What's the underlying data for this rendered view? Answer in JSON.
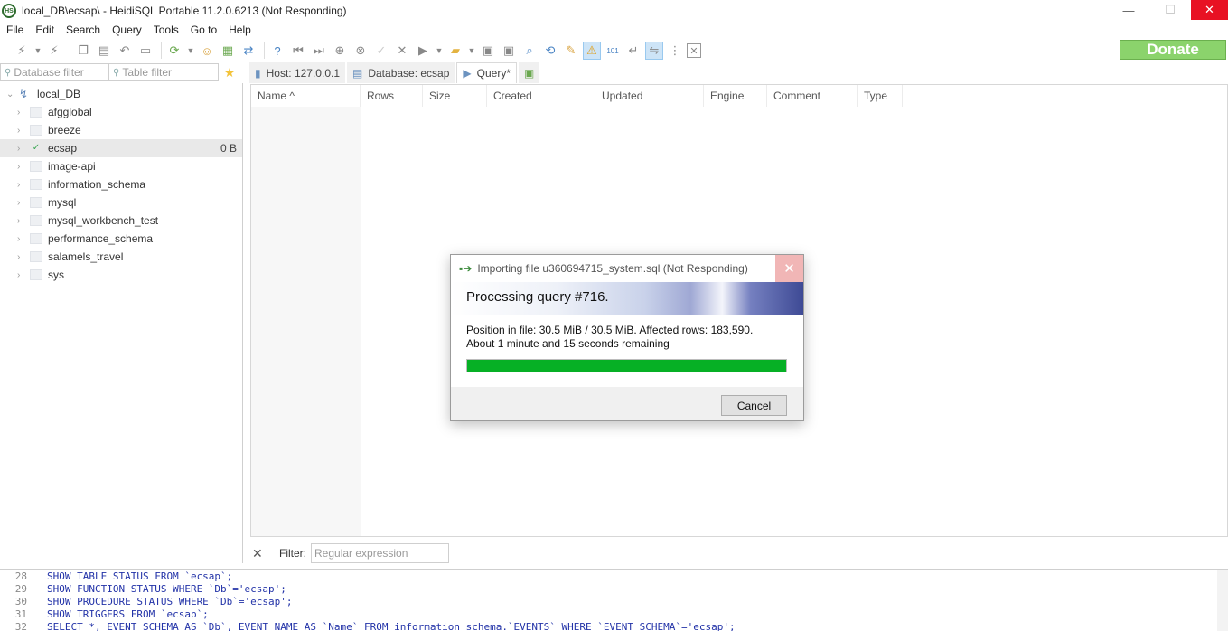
{
  "window": {
    "title": "local_DB\\ecsap\\ - HeidiSQL Portable 11.2.0.6213 (Not Responding)",
    "icon": "heidisql-icon",
    "controls": {
      "minimize": "—",
      "maximize": "☐",
      "close": "✕"
    }
  },
  "menu": [
    "File",
    "Edit",
    "Search",
    "Query",
    "Tools",
    "Go to",
    "Help"
  ],
  "toolbar": {
    "donate_label": "Donate",
    "icons": [
      "connect-icon",
      "dropdown-icon",
      "disconnect-icon",
      "copy-icon",
      "paste-icon",
      "undo-icon",
      "print-icon",
      "refresh-icon",
      "dropdown-icon",
      "user-manager-icon",
      "export-icon",
      "sync-icon",
      "help-icon",
      "first-icon",
      "last-icon",
      "add-icon",
      "remove-icon",
      "apply-icon",
      "cancel-icon",
      "run-icon",
      "dropdown-icon",
      "open-folder-icon",
      "dropdown-icon",
      "save-icon",
      "save-as-icon",
      "find-icon",
      "replace-icon",
      "format-icon",
      "warning-icon",
      "binary-icon",
      "wrap-icon",
      "reformat-icon",
      "more-icon",
      "close-icon"
    ]
  },
  "filters": {
    "database_filter_placeholder": "Database filter",
    "table_filter_placeholder": "Table filter"
  },
  "tabs": [
    {
      "label": "Host: 127.0.0.1",
      "icon": "host-icon"
    },
    {
      "label": "Database: ecsap",
      "icon": "database-icon"
    },
    {
      "label": "Query*",
      "icon": "query-icon"
    },
    {
      "label": "",
      "icon": "new-query-tab-icon"
    }
  ],
  "tree": {
    "root": "local_DB",
    "items": [
      {
        "label": "afgglobal",
        "size": ""
      },
      {
        "label": "breeze",
        "size": ""
      },
      {
        "label": "ecsap",
        "size": "0 B",
        "selected": true
      },
      {
        "label": "image-api",
        "size": ""
      },
      {
        "label": "information_schema",
        "size": ""
      },
      {
        "label": "mysql",
        "size": ""
      },
      {
        "label": "mysql_workbench_test",
        "size": ""
      },
      {
        "label": "performance_schema",
        "size": ""
      },
      {
        "label": "salamels_travel",
        "size": ""
      },
      {
        "label": "sys",
        "size": ""
      }
    ]
  },
  "table": {
    "columns": [
      "Name ^",
      "Rows",
      "Size",
      "Created",
      "Updated",
      "Engine",
      "Comment",
      "Type"
    ]
  },
  "bottom_filter": {
    "label": "Filter:",
    "placeholder": "Regular expression"
  },
  "sql_log": [
    {
      "line": "28",
      "text": "SHOW TABLE STATUS FROM `ecsap`;"
    },
    {
      "line": "29",
      "text": "SHOW FUNCTION STATUS WHERE `Db`='ecsap';"
    },
    {
      "line": "30",
      "text": "SHOW PROCEDURE STATUS WHERE `Db`='ecsap';"
    },
    {
      "line": "31",
      "text": "SHOW TRIGGERS FROM `ecsap`;"
    },
    {
      "line": "32",
      "text": "SELECT *, EVENT_SCHEMA AS `Db`, EVENT_NAME AS `Name` FROM information_schema.`EVENTS` WHERE `EVENT_SCHEMA`='ecsap';"
    }
  ],
  "dialog": {
    "title": "Importing file u360694715_system.sql (Not Responding)",
    "heading": "Processing query #716.",
    "position_text": "Position in file: 30.5 MiB / 30.5 MiB. Affected rows: 183,590.",
    "remaining_text": "About 1 minute and 15 seconds remaining",
    "progress_fraction": 1.0,
    "cancel_label": "Cancel",
    "close_symbol": "✕"
  },
  "colors": {
    "progress": "#06b025",
    "donate_bg": "#8bd36c",
    "close_button": "#e81123",
    "sql_keyword": "#2333a8"
  }
}
